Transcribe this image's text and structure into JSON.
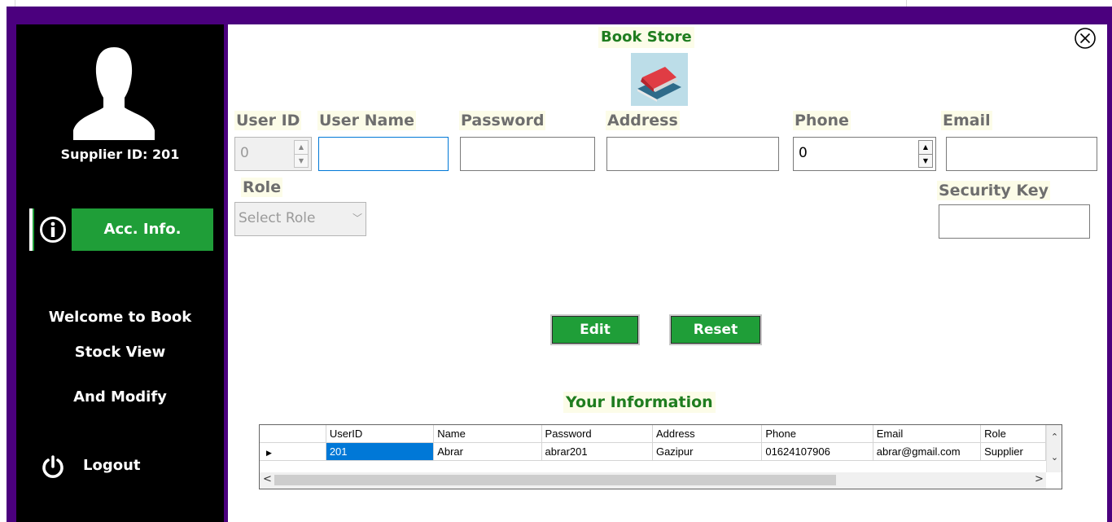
{
  "app": {
    "title": "Book Store"
  },
  "sidebar": {
    "supplier_label": "Supplier ID: 201",
    "acc_info_label": "Acc. Info.",
    "welcome_lines": [
      "Welcome to Book",
      "Stock View",
      "And Modify"
    ],
    "logout_label": "Logout",
    "acc_info_color": "#1f9e38"
  },
  "form": {
    "user_id": {
      "label": "User ID",
      "value": "0"
    },
    "user_name": {
      "label": "User Name",
      "value": ""
    },
    "password": {
      "label": "Password",
      "value": ""
    },
    "address": {
      "label": "Address",
      "value": ""
    },
    "phone": {
      "label": "Phone",
      "value": "0"
    },
    "email": {
      "label": "Email",
      "value": ""
    },
    "role": {
      "label": "Role",
      "selected": "Select Role"
    },
    "security_key": {
      "label": "Security Key",
      "value": ""
    }
  },
  "buttons": {
    "edit": "Edit",
    "reset": "Reset"
  },
  "info": {
    "title": "Your Information",
    "columns": [
      "UserID",
      "Name",
      "Password",
      "Address",
      "Phone",
      "Email",
      "Role"
    ],
    "rows": [
      [
        "201",
        "Abrar",
        "abrar201",
        "Gazipur",
        "01624107906",
        "abrar@gmail.com",
        "Supplier"
      ]
    ]
  },
  "colors": {
    "frame": "#4b007e",
    "accent": "#1f9e38",
    "title": "#1f7d1f",
    "selection": "#0078d7"
  }
}
